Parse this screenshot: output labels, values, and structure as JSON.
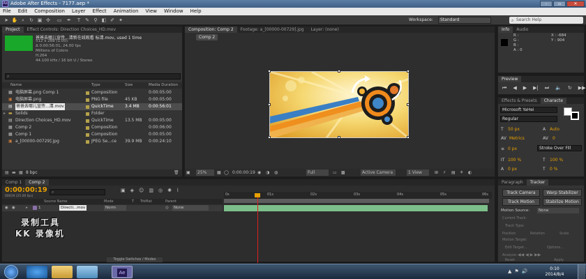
{
  "window": {
    "title": "Adobe After Effects - 7177.aep *",
    "logo": "Ae"
  },
  "menu": [
    "File",
    "Edit",
    "Composition",
    "Layer",
    "Effect",
    "Animation",
    "View",
    "Window",
    "Help"
  ],
  "toolbar": {
    "workspace_label": "Workspace:",
    "workspace_value": "Standard",
    "search_placeholder": "Search Help"
  },
  "project": {
    "tab_project": "Project",
    "tab_effect_controls": "Effect Controls: Direction Choices_HD.mov",
    "preview_name": "爸爸去哪儿宣传...清新在线观看 标清.mov",
    "preview_used": ", used 1 time",
    "meta": [
      "512 x 288 (1.00)",
      "Δ 0:00:56:01, 24.00 fps",
      "Millions of Colors",
      "H.264",
      "44.100 kHz / 16 bit U / Stereo"
    ],
    "columns": {
      "name": "Name",
      "type": "Type",
      "size": "Size",
      "duration": "Media Duration"
    },
    "items": [
      {
        "name": "电脑屏幕.png Comp 1",
        "type": "Composition",
        "size": "",
        "duration": "0:00:05:00",
        "color": "#b6a24b",
        "icon": "comp-icon"
      },
      {
        "name": "电脑屏幕.png",
        "type": "PNG file",
        "size": "45 KB",
        "duration": "0:00:05:00",
        "color": "#b6a24b",
        "icon": "image-icon"
      },
      {
        "name": "爸爸去哪儿宣传...清.mov",
        "type": "QuickTime",
        "size": "3.4 MB",
        "duration": "0:00:56:01",
        "color": "#b6a24b",
        "icon": "movie-icon"
      },
      {
        "name": "Solids",
        "type": "Folder",
        "size": "",
        "duration": "",
        "color": "#b6a24b",
        "icon": "folder-icon"
      },
      {
        "name": "Direction Choices_HD.mov",
        "type": "QuickTime",
        "size": "13.5 MB",
        "duration": "0:00:05:00",
        "color": "#b6a24b",
        "icon": "movie-icon"
      },
      {
        "name": "Comp 2",
        "type": "Composition",
        "size": "",
        "duration": "0:00:06:00",
        "color": "#b6a24b",
        "icon": "comp-icon"
      },
      {
        "name": "Comp 1",
        "type": "Composition",
        "size": "",
        "duration": "0:00:05:00",
        "color": "#b6a24b",
        "icon": "comp-icon"
      },
      {
        "name": "a_[00000-00729].jpg",
        "type": "JPEG Se...ce",
        "size": "39.9 MB",
        "duration": "0:00:24:10",
        "color": "#b6a24b",
        "icon": "image-icon"
      }
    ],
    "bpc": "8 bpc"
  },
  "viewer": {
    "tab_comp": "Composition: Comp 2",
    "tab_footage": "Footage: a_[00000-00729].jpg",
    "tab_layer": "Layer: (none)",
    "comp_chip": "Comp 2",
    "zoom": "25%",
    "timecode": "0:00:00:19",
    "resolution": "Full",
    "camera": "Active Camera",
    "view": "1 View"
  },
  "info": {
    "tab_info": "Info",
    "tab_audio": "Audio",
    "r": "R :",
    "g": "G :",
    "b": "B :",
    "a": "A : 0",
    "x": "X : -684",
    "y": "Y : 904"
  },
  "preview": {
    "tab": "Preview"
  },
  "character": {
    "tab_effects": "Effects & Presets",
    "tab_character": "Characte",
    "font": "Microsoft YaHei",
    "style": "Regular",
    "size": "50 px",
    "leading": "Auto",
    "kerning": "Metrics",
    "tracking": "0",
    "stroke_size": "0 px",
    "stroke_mode": "Stroke Over Fill",
    "vscale": "100 %",
    "hscale": "100 %",
    "baseline": "0 px",
    "tsume": "0 %"
  },
  "timeline": {
    "tab_comp1": "Comp 1",
    "tab_comp2": "Comp 2",
    "timecode": "0:00:00:19",
    "frame_info": "00019 (25.00 fps)",
    "col_source": "Source Name",
    "col_mode": "Mode",
    "col_t": "T",
    "col_trkmat": "TrkMat",
    "col_parent": "Parent",
    "layer_num": "1",
    "layer_name": "Directi...mov",
    "layer_mode": "Norm",
    "layer_parent": "None",
    "ruler": [
      "0s",
      "01s",
      "02s",
      "03s",
      "04s",
      "05s",
      "06s"
    ],
    "toggle": "Toggle Switches / Modes"
  },
  "tracker": {
    "tab_paragraph": "Paragraph",
    "tab_tracker": "Tracker",
    "track_camera": "Track Camera",
    "warp_stabilizer": "Warp Stabilizer",
    "track_motion": "Track Motion",
    "stabilize_motion": "Stabilize Motion",
    "motion_source_label": "Motion Source:",
    "motion_source_value": "None",
    "current_track": "Current Track:",
    "track_type": "Track Type:",
    "position": "Position",
    "rotation": "Rotation",
    "scale": "Scale",
    "motion_target": "Motion Target:",
    "edit_target": "Edit Target...",
    "options": "Options...",
    "analyze": "Analyze:",
    "reset": "Reset",
    "apply": "Apply"
  },
  "watermark": {
    "line1": "录制工具",
    "line2": "KK 录像机"
  },
  "taskbar": {
    "time": "0:10",
    "date": "2014/8/4"
  },
  "colors": {
    "accent": "#f0a000",
    "playhead": "#e02020",
    "layer_bar": "#7dbf8a"
  }
}
